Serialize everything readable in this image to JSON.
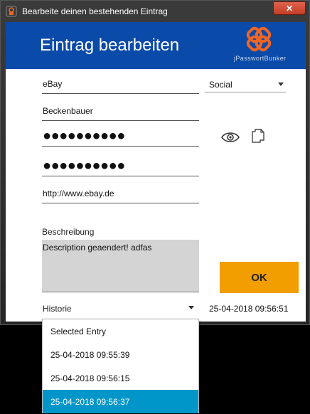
{
  "window": {
    "title": "Bearbeite deinen bestehenden Eintrag",
    "close_glyph": "✕"
  },
  "header": {
    "title": "Eintrag bearbeiten",
    "brand": "jPasswortBunker",
    "logo_icon": "chain-link-logo",
    "background": "#0a4aa9",
    "logo_color": "#f26522"
  },
  "form": {
    "name": "eBay",
    "username": "Beckenbauer",
    "password_mask": "●●●●●●●●●●",
    "password_repeat_mask": "●●●●●●●●●●",
    "url": "http://www.ebay.de",
    "category": "Social",
    "description_label": "Beschreibung",
    "description": "Description geaendert! adfas"
  },
  "icons": {
    "show_password": "eye-icon",
    "copy_password": "copy-icon"
  },
  "ok_button": {
    "label": "OK",
    "color": "#f29d00"
  },
  "history": {
    "label": "Historie",
    "current_date": "25-04-2018 09:56:51",
    "options": [
      "Selected Entry",
      "25-04-2018 09:55:39",
      "25-04-2018 09:56:15",
      "25-04-2018 09:56:37"
    ],
    "highlighted_index": 3,
    "highlight_color": "#0096c9"
  }
}
